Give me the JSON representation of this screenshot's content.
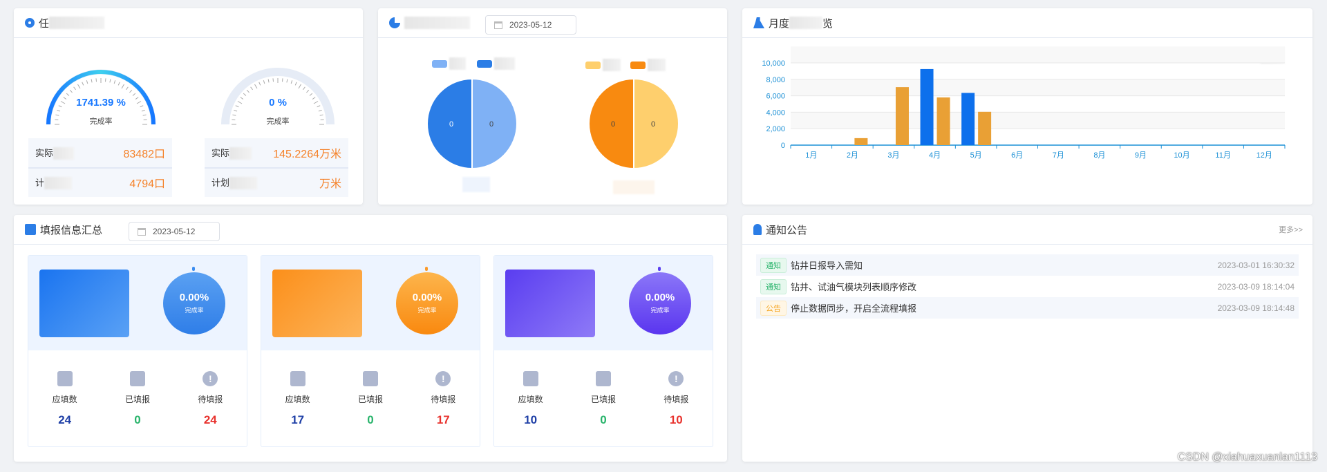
{
  "card_progress": {
    "title_visible": "任",
    "gauges": [
      {
        "value_text": "1741.39 %",
        "label": "完成率",
        "fraction": 1.0
      },
      {
        "value_text": "0 %",
        "label": "完成率",
        "fraction": 0
      }
    ],
    "stats": [
      {
        "r1_label": "实际",
        "r1_value": "83482口",
        "r2_label": "计",
        "r2_value": "4794口"
      },
      {
        "r1_label": "实际",
        "r1_value": "145.2264万米",
        "r2_label": "计划",
        "r2_value": "万米"
      }
    ]
  },
  "card_pie": {
    "date": "2023-05-12",
    "pies": [
      {
        "values": [
          0,
          0
        ],
        "labels": [
          "0",
          "0"
        ],
        "colors": [
          "#2b7de6",
          "#7fb1f5"
        ]
      },
      {
        "values": [
          0,
          0
        ],
        "labels": [
          "0",
          "0"
        ],
        "colors": [
          "#f88a10",
          "#fecf6d"
        ]
      }
    ]
  },
  "card_monthly": {
    "title_prefix": "月度",
    "title_suffix": "览"
  },
  "chart_data": {
    "type": "bar",
    "categories": [
      "1月",
      "2月",
      "3月",
      "4月",
      "5月",
      "6月",
      "7月",
      "8月",
      "9月",
      "10月",
      "11月",
      "12月"
    ],
    "series": [
      {
        "name": "",
        "color": "#0d70ec",
        "values": [
          0,
          0,
          0,
          9250,
          6350,
          0,
          0,
          0,
          0,
          0,
          0,
          0
        ]
      },
      {
        "name": "",
        "color": "#e9a035",
        "values": [
          0,
          850,
          7050,
          5800,
          4050,
          0,
          0,
          0,
          0,
          0,
          0,
          0
        ]
      }
    ],
    "ylim": [
      0,
      10000
    ],
    "yticks": [
      "0",
      "2,000",
      "4,000",
      "6,000",
      "8,000",
      "10,000"
    ],
    "grid": true,
    "legend": "top-right"
  },
  "card_fill": {
    "title": "填报信息汇总",
    "date": "2023-05-12",
    "items": [
      {
        "rate": "0.00%",
        "rate_label": "完成率",
        "labels": [
          "应填数",
          "已填报",
          "待填报"
        ],
        "values": [
          "24",
          "0",
          "24"
        ]
      },
      {
        "rate": "0.00%",
        "rate_label": "完成率",
        "labels": [
          "应填数",
          "已填报",
          "待填报"
        ],
        "values": [
          "17",
          "0",
          "17"
        ]
      },
      {
        "rate": "0.00%",
        "rate_label": "完成率",
        "labels": [
          "应填数",
          "已填报",
          "待填报"
        ],
        "values": [
          "10",
          "0",
          "10"
        ]
      }
    ]
  },
  "card_notice": {
    "title": "通知公告",
    "more": "更多>>",
    "items": [
      {
        "tag": "通知",
        "title": "钻井日报导入需知",
        "time": "2023-03-01 16:30:32"
      },
      {
        "tag": "通知",
        "title": "钻井、试油气模块列表顺序修改",
        "time": "2023-03-09 18:14:04"
      },
      {
        "tag": "公告",
        "title": "停止数据同步，开启全流程填报",
        "time": "2023-03-09 18:14:48"
      }
    ]
  },
  "watermark": "CSDN @xiahuaxuanlan1113"
}
